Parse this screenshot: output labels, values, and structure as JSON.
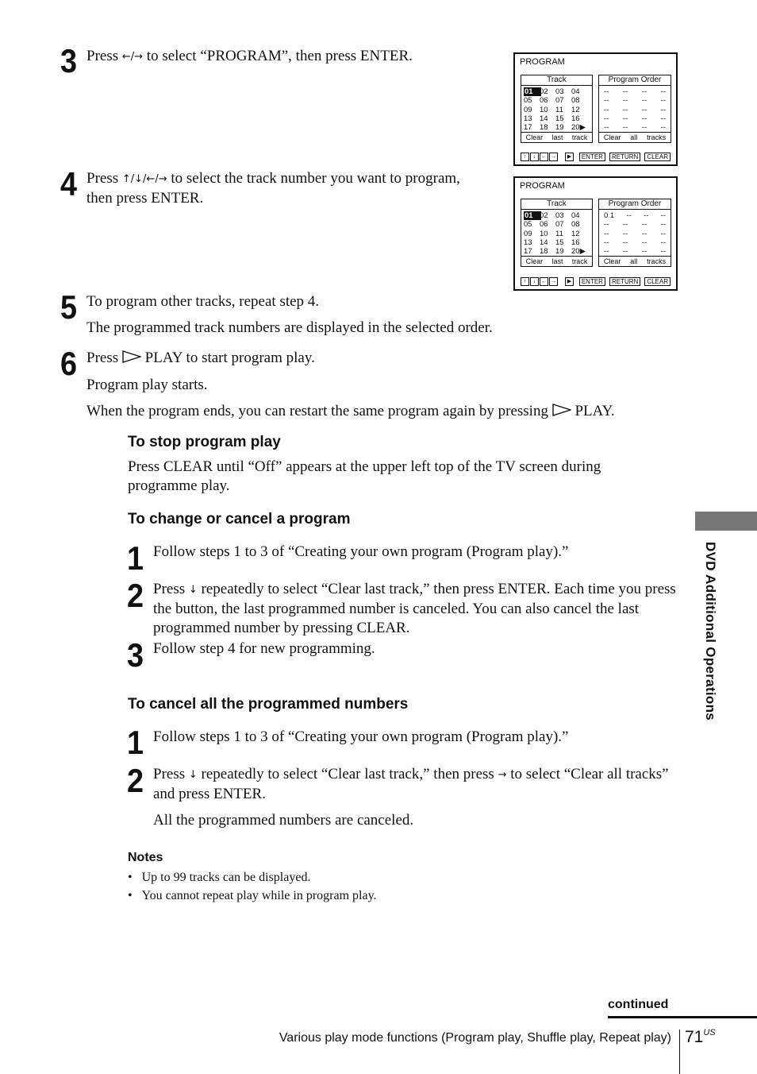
{
  "steps_main": [
    {
      "num": "3",
      "text_before": "Press ",
      "arrows": "←/→",
      "text_after": " to select “PROGRAM”, then press ENTER."
    },
    {
      "num": "4",
      "text_before": "Press ",
      "arrows": "↑/↓/←/→",
      "text_after": " to select the track number you want to program, then press ENTER."
    },
    {
      "num": "5",
      "text": "To program other tracks, repeat step 4.",
      "sub": "The programmed track numbers are displayed in the selected order."
    },
    {
      "num": "6",
      "text_before": "Press ",
      "text_after": " PLAY to start program play.",
      "sub1": "Program play starts.",
      "sub2_before": "When the program ends, you can restart the same program again by pressing ",
      "sub2_after": " PLAY."
    }
  ],
  "osd_screens": [
    {
      "title": "PROGRAM",
      "track_header": "Track",
      "order_header": "Program Order",
      "tracks": [
        [
          "01",
          "02",
          "03",
          "04"
        ],
        [
          "05",
          "06",
          "07",
          "08"
        ],
        [
          "09",
          "10",
          "11",
          "12"
        ],
        [
          "13",
          "14",
          "15",
          "16"
        ],
        [
          "17",
          "18",
          "19",
          "20▶"
        ]
      ],
      "selected_track": "01",
      "order": [
        [
          "--",
          "--",
          "--",
          "--"
        ],
        [
          "--",
          "--",
          "--",
          "--"
        ],
        [
          "--",
          "--",
          "--",
          "--"
        ],
        [
          "--",
          "--",
          "--",
          "--"
        ],
        [
          "--",
          "--",
          "--",
          "--"
        ]
      ],
      "track_footer": [
        "Clear",
        "last",
        "track"
      ],
      "order_footer": [
        "Clear",
        "all",
        "tracks"
      ],
      "keys": [
        "↑",
        "↓",
        "←",
        "→"
      ],
      "play_key": "▶",
      "buttons": [
        "ENTER",
        "RETURN",
        "CLEAR"
      ]
    },
    {
      "title": "PROGRAM",
      "track_header": "Track",
      "order_header": "Program Order",
      "tracks": [
        [
          "01",
          "02",
          "03",
          "04"
        ],
        [
          "05",
          "06",
          "07",
          "08"
        ],
        [
          "09",
          "10",
          "11",
          "12"
        ],
        [
          "13",
          "14",
          "15",
          "16"
        ],
        [
          "17",
          "18",
          "19",
          "20▶"
        ]
      ],
      "selected_track": "01",
      "order": [
        [
          "0 1",
          "--",
          "--",
          "--"
        ],
        [
          "--",
          "--",
          "--",
          "--"
        ],
        [
          "--",
          "--",
          "--",
          "--"
        ],
        [
          "--",
          "--",
          "--",
          "--"
        ],
        [
          "--",
          "--",
          "--",
          "--"
        ]
      ],
      "track_footer": [
        "Clear",
        "last",
        "track"
      ],
      "order_footer": [
        "Clear",
        "all",
        "tracks"
      ],
      "keys": [
        "↑",
        "↓",
        "←",
        "→"
      ],
      "play_key": "▶",
      "buttons": [
        "ENTER",
        "RETURN",
        "CLEAR"
      ]
    }
  ],
  "stop_section": {
    "heading": "To stop program play",
    "text": "Press CLEAR until “Off” appears at the upper left top of the TV screen during programme play."
  },
  "change_section": {
    "heading": "To change or cancel a program",
    "steps": [
      {
        "num": "1",
        "text": "Follow steps 1 to 3 of “Creating your own program (Program play).”"
      },
      {
        "num": "2",
        "text_before": "Press ",
        "arrow": "↓",
        "text_after": " repeatedly to select “Clear last track,” then press ENTER. Each time you press the button, the last programmed number is canceled. You can also cancel the last programmed number by pressing CLEAR."
      },
      {
        "num": "3",
        "text": "Follow step 4 for new programming."
      }
    ]
  },
  "cancel_all_section": {
    "heading": "To cancel all the programmed numbers",
    "steps": [
      {
        "num": "1",
        "text": "Follow steps 1 to 3 of “Creating your own program (Program play).”"
      },
      {
        "num": "2",
        "text_before": "Press ",
        "arrow1": "↓",
        "text_mid": " repeatedly to select “Clear last track,” then press ",
        "arrow2": "→",
        "text_after": " to select “Clear all tracks” and press ENTER.",
        "sub": "All the programmed numbers are canceled."
      }
    ]
  },
  "notes": {
    "heading": "Notes",
    "items": [
      "Up to 99 tracks can be displayed.",
      "You cannot repeat play while in program play."
    ]
  },
  "side_tab": {
    "label": "DVD Additional Operations"
  },
  "footer": {
    "continued": "continued",
    "section_title": "Various play mode functions (Program play, Shuffle play, Repeat play)",
    "page_number": "71",
    "page_suffix": "US"
  }
}
